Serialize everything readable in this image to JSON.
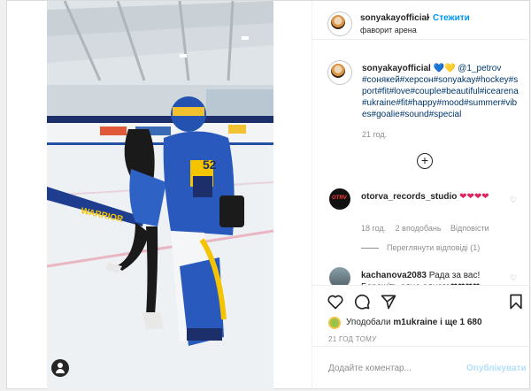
{
  "header": {
    "username": "sonyakayofficial",
    "dot": "•",
    "follow_label": "Стежити",
    "location": "фаворит арена"
  },
  "caption": {
    "username": "sonyakayofficial",
    "heart1": "💙",
    "heart2": "💛",
    "mention": "@1_petrov",
    "hashtags": "#сонякей#херсон#sonyakay#hockey#sport#fit#love#couple#beautiful#icearena#ukraine#fit#happy#mood#summer#vibes#goalie#sound#special",
    "time": "21 год."
  },
  "more_button": "+",
  "comments": [
    {
      "avatar_text": "OTRV",
      "username": "otorva_records_studio",
      "text": "❤❤❤❤",
      "time": "18 год.",
      "likes": "2 вподобань",
      "reply_label": "Відповісти",
      "view_replies": "Переглянути відповіді (1)"
    },
    {
      "username": "kachanova2083",
      "text": "Рада за вас! Бережіть одне одного❤❤❤❤"
    }
  ],
  "likes": {
    "prefix": "Уподобали",
    "user": "m1ukraine",
    "suffix": "і ще 1 680"
  },
  "date": "21 ГОД ТОМУ",
  "comment_input": {
    "placeholder": "Додайте коментар...",
    "publish_label": "Опублікувати"
  },
  "colors": {
    "accent": "#0095f6",
    "publish_disabled": "#b2dffc",
    "heart_red": "#e0245e"
  },
  "icons": [
    "user-tag-icon",
    "heart-icon",
    "comment-icon",
    "share-icon",
    "bookmark-icon",
    "add-icon"
  ]
}
